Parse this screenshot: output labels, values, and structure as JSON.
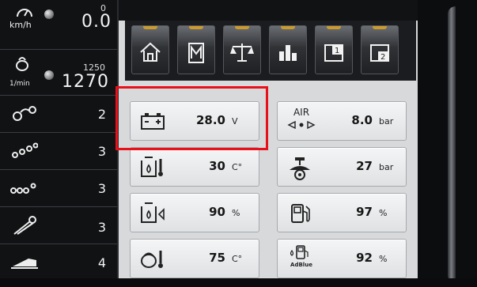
{
  "left_panel": {
    "speed": {
      "unit": "km/h",
      "target": "0",
      "value": "0.0",
      "icon": "speedometer-icon"
    },
    "rpm": {
      "unit": "1/min",
      "target": "1250",
      "value": "1270",
      "icon": "engine-speed-icon"
    },
    "rows": [
      {
        "icon": "hydraulic-circuit-1-icon",
        "value": "2"
      },
      {
        "icon": "hydraulic-circuit-2-icon",
        "value": "3"
      },
      {
        "icon": "hydraulic-circuit-3-icon",
        "value": "3"
      },
      {
        "icon": "boom-arm-icon",
        "value": "3"
      },
      {
        "icon": "attachment-icon",
        "value": "4"
      }
    ]
  },
  "tabs": [
    {
      "icon": "home-icon"
    },
    {
      "icon": "menu-m-icon"
    },
    {
      "icon": "scale-icon"
    },
    {
      "icon": "bar-chart-icon"
    },
    {
      "icon": "page-1-icon",
      "label": "1"
    },
    {
      "icon": "page-2-icon",
      "label": "2"
    }
  ],
  "gauges": {
    "battery": {
      "value": "28.0",
      "unit": "V",
      "icon": "battery-icon"
    },
    "air": {
      "label": "AIR",
      "value": "8.0",
      "unit": "bar",
      "icon": "air-pressure-icon"
    },
    "hydraulic_temp": {
      "value": "30",
      "unit": "C°",
      "icon": "hydraulic-oil-temperature-icon"
    },
    "tire_pressure": {
      "value": "27",
      "unit": "bar",
      "icon": "tire-pressure-icon"
    },
    "hydraulic_level": {
      "value": "90",
      "unit": "%",
      "icon": "hydraulic-oil-level-icon"
    },
    "fuel": {
      "value": "97",
      "unit": "%",
      "icon": "fuel-icon"
    },
    "coolant_temp": {
      "value": "75",
      "unit": "C°",
      "icon": "engine-temperature-icon"
    },
    "adblue": {
      "label": "AdBlue",
      "value": "92",
      "unit": "%",
      "icon": "adblue-icon"
    }
  },
  "colors": {
    "highlight": "#e8101a",
    "tab_accent": "#c99a2e"
  }
}
